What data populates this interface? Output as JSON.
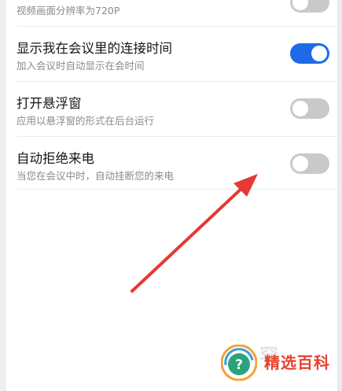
{
  "settings": {
    "partial_top": {
      "subtitle": "视频画面分辨率为720P",
      "toggle_state": "off"
    },
    "items": [
      {
        "title": "显示我在会议里的连接时间",
        "subtitle": "加入会议时自动显示在会时间",
        "toggle_state": "on"
      },
      {
        "title": "打开悬浮窗",
        "subtitle": "应用以悬浮窗的形式在后台运行",
        "toggle_state": "off"
      },
      {
        "title": "自动拒绝来电",
        "subtitle": "当您在会议中时，自动挂断您的来电",
        "toggle_state": "off"
      }
    ]
  },
  "colors": {
    "toggle_on": "#1e6be6",
    "toggle_off": "#c9c9c9",
    "annotation_arrow": "#e53935"
  },
  "watermark": {
    "title": "精选百科",
    "domain": "booso.com",
    "icon": "question-mark-icon"
  }
}
